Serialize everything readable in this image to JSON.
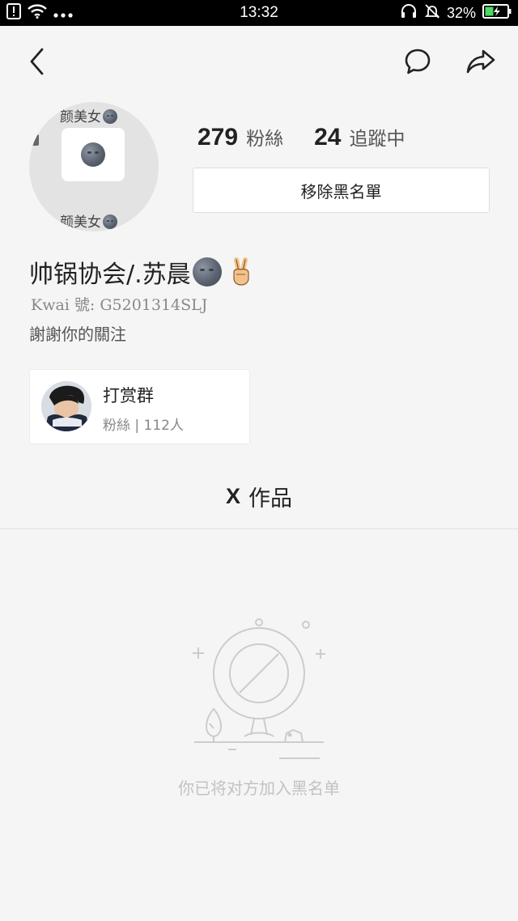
{
  "status_bar": {
    "time": "13:32",
    "battery_percent": "32%",
    "left_icons": [
      "alert-icon",
      "wifi-icon",
      "more-dots-icon"
    ],
    "right_icons": [
      "headset-icon",
      "silent-bell-icon",
      "battery-charging-icon"
    ]
  },
  "nav": {
    "back_icon": "chevron-left-icon",
    "message_icon": "chat-bubble-icon",
    "share_icon": "share-arrow-icon"
  },
  "avatar": {
    "tag_top": "颜美女",
    "tag_bottom": "颜美女"
  },
  "stats": {
    "followers_count": "279",
    "followers_label": "粉絲",
    "following_count": "24",
    "following_label": "追蹤中"
  },
  "remove_blacklist_label": "移除黑名單",
  "profile": {
    "username": "帅锅协会/.苏晨",
    "kwai_id": "Kwai 號: G5201314SLJ",
    "bio": "謝謝你的關注"
  },
  "group": {
    "name": "打赏群",
    "meta": "粉絲 | 112人"
  },
  "works_tab": {
    "prefix": "X",
    "label": "作品"
  },
  "empty_state": {
    "text": "你已将对方加入黑名单"
  },
  "colors": {
    "background": "#f5f5f5",
    "status_bar": "#000000",
    "battery": "#4cd964",
    "muted_text": "#888888",
    "empty_text": "#c2c2c2"
  }
}
